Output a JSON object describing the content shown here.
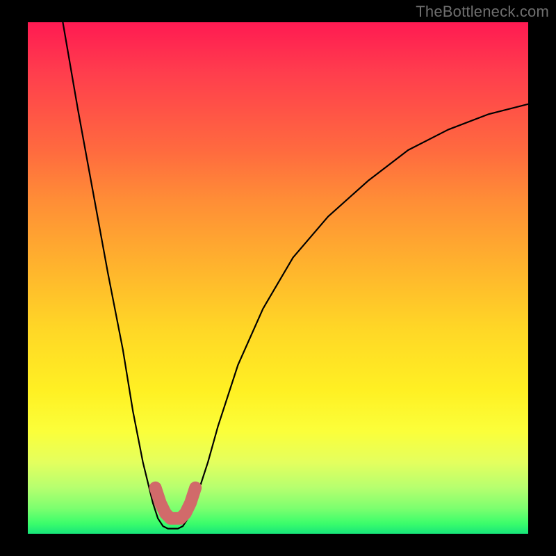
{
  "watermark": "TheBottleneck.com",
  "chart_data": {
    "type": "line",
    "title": "",
    "xlabel": "",
    "ylabel": "",
    "xlim": [
      0,
      100
    ],
    "ylim": [
      0,
      100
    ],
    "grid": false,
    "legend": false,
    "series": [
      {
        "name": "bottleneck-curve",
        "x": [
          7,
          10,
          13,
          16,
          19,
          21,
          23,
          25,
          26,
          27,
          28,
          29,
          30,
          31,
          32,
          33,
          34,
          36,
          38,
          42,
          47,
          53,
          60,
          68,
          76,
          84,
          92,
          100
        ],
        "values": [
          100,
          83,
          67,
          51,
          36,
          24,
          14,
          6,
          3,
          1.5,
          1,
          1,
          1,
          1.5,
          3,
          5,
          8,
          14,
          21,
          33,
          44,
          54,
          62,
          69,
          75,
          79,
          82,
          84
        ]
      }
    ],
    "highlight": {
      "name": "bottleneck-minimum",
      "color": "#d16a6a",
      "x": [
        25.5,
        26.5,
        27.5,
        28.5,
        29.5,
        30.5,
        31.5,
        32.5,
        33.5
      ],
      "values": [
        9,
        6,
        4,
        3,
        3,
        3,
        4,
        6,
        9
      ]
    },
    "background_gradient": {
      "stops": [
        {
          "offset": 0,
          "color": "#ff1a52"
        },
        {
          "offset": 25,
          "color": "#ff6a3f"
        },
        {
          "offset": 50,
          "color": "#ffc628"
        },
        {
          "offset": 75,
          "color": "#fff427"
        },
        {
          "offset": 90,
          "color": "#c7ff66"
        },
        {
          "offset": 100,
          "color": "#17e57a"
        }
      ]
    }
  }
}
